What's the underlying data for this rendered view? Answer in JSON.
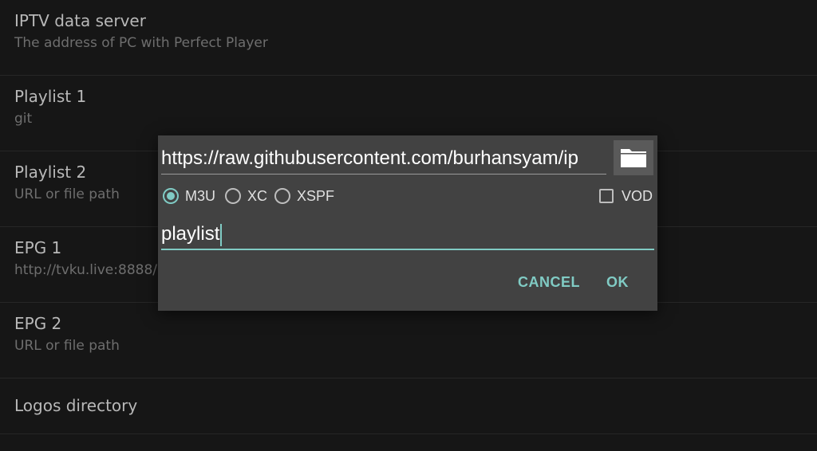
{
  "settings": {
    "items": [
      {
        "title": "IPTV data server",
        "summary": "The address of PC with Perfect Player"
      },
      {
        "title": "Playlist 1",
        "summary": "git"
      },
      {
        "title": "Playlist 2",
        "summary": "URL or file path"
      },
      {
        "title": "EPG 1",
        "summary": "http://tvku.live:8888/"
      },
      {
        "title": "EPG 2",
        "summary": "URL or file path"
      },
      {
        "title": "Logos directory",
        "summary": ""
      }
    ]
  },
  "dialog": {
    "url_value": "https://raw.githubusercontent.com/burhansyam/ip",
    "folder_icon": "folder-icon",
    "radio_options": [
      {
        "label": "M3U",
        "checked": true
      },
      {
        "label": "XC",
        "checked": false
      },
      {
        "label": "XSPF",
        "checked": false
      }
    ],
    "vod": {
      "label": "VOD",
      "checked": false
    },
    "name_value": "playlist",
    "cancel_label": "CANCEL",
    "ok_label": "OK"
  },
  "colors": {
    "background": "#161616",
    "dialog": "#424242",
    "accent": "#80cbc4"
  }
}
